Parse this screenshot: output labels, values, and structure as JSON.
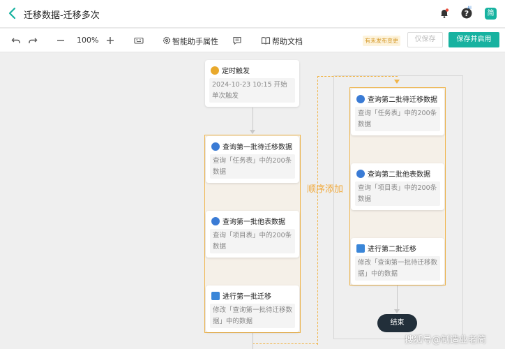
{
  "header": {
    "title": "迁移数据-迁移多次",
    "avatar_text": "简",
    "ai_badge": "AI"
  },
  "toolbar": {
    "zoom": "100%",
    "assistant_label": "智能助手属性",
    "help_label": "帮助文档",
    "unpublished_tag": "有未发布变更",
    "save_label": "仅保存",
    "save_enable_label": "保存并启用"
  },
  "flow": {
    "trigger": {
      "title": "定时触发",
      "desc": "2024-10-23 10:15 开始单次触发"
    },
    "left": [
      {
        "title": "查询第一批待迁移数据",
        "desc": "查询「任务表」中的200条数据"
      },
      {
        "title": "查询第一批他表数据",
        "desc": "查询「项目表」中的200条数据"
      },
      {
        "title": "进行第一批迁移",
        "desc": "修改「查询第一批待迁移数据」中的数据"
      }
    ],
    "right": [
      {
        "title": "查询第二批待迁移数据",
        "desc": "查询「任务表」中的200条数据"
      },
      {
        "title": "查询第二批他表数据",
        "desc": "查询「项目表」中的200条数据"
      },
      {
        "title": "进行第二批迁移",
        "desc": "修改「查询第一批待迁移数据」中的数据"
      }
    ],
    "sequence_label": "顺序添加",
    "end_label": "结束"
  },
  "watermark": "搜狐号@制造业老简",
  "colors": {
    "accent": "#17b2a0",
    "orange": "#f0b54a",
    "query_icon": "#3a7bd5",
    "edit_icon": "#3a86d8",
    "trigger_icon": "#e9a92c"
  }
}
